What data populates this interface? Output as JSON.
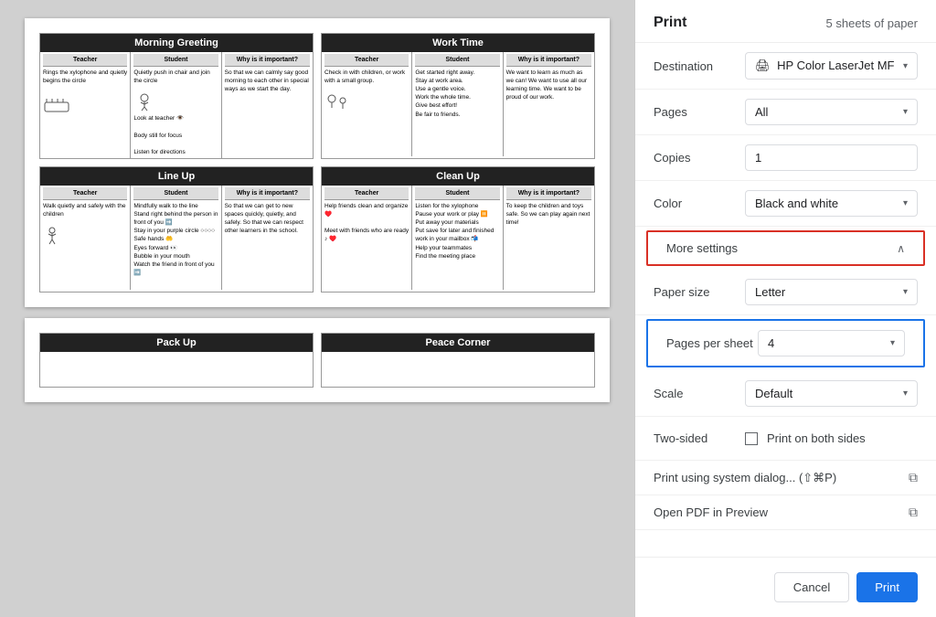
{
  "preview": {
    "page1": {
      "cards": [
        {
          "title": "Morning Greeting",
          "cols": [
            {
              "header": "Teacher",
              "content": "Rings the xylophone and quietly begins the circle"
            },
            {
              "header": "Student",
              "content": "Quietly push in chair and join the circle\n\nLook at teacher 👁️\n\nBody still for focus\n\nListen for directions"
            },
            {
              "header": "Why is it important?",
              "content": "So that we can calmly say good morning to each other in special ways as we start the day."
            }
          ]
        },
        {
          "title": "Work Time",
          "cols": [
            {
              "header": "Teacher",
              "content": "Check in with children, or work with a small group."
            },
            {
              "header": "Student",
              "content": "Get started right away.\nStay at work area.\nUse a gentle voice.\nWork the whole time.\nGive best effort!\nBe fair to friends."
            },
            {
              "header": "Why is it important?",
              "content": "We want to learn as much as we can!\nWe want to use all our learning time.\nWe want to be proud of our work."
            }
          ]
        },
        {
          "title": "Line Up",
          "cols": [
            {
              "header": "Teacher",
              "content": "Walk quietly and safely with the children"
            },
            {
              "header": "Student",
              "content": "Mindfully walk to the line\nStand right behind the person in front of you\nStay in your purple circle\nSafe hands\nEyes forward\nBubble in your mouth\nWatch the friend in front of you"
            },
            {
              "header": "Why is it important?",
              "content": "So that we can get to new spaces quickly, quietly, and safely.\nSo that we can respect other learners in the school."
            }
          ]
        },
        {
          "title": "Clean Up",
          "cols": [
            {
              "header": "Teacher",
              "content": "Help friends clean and organize\nMeet with friends who are ready"
            },
            {
              "header": "Student",
              "content": "Listen for the xylophone\nPause your work or play\nPut away your materials\nPut save for later and finished work in your mailbox\nHelp your teammates\nFind the meeting place"
            },
            {
              "header": "Why is it important?",
              "content": "To keep the children and toys safe.\nSo we can play again next time!"
            }
          ]
        }
      ]
    },
    "page2": {
      "cards": [
        {
          "title": "Pack Up",
          "partial": true
        },
        {
          "title": "Peace Corner",
          "partial": true
        }
      ]
    }
  },
  "settings": {
    "title": "Print",
    "sheets_info": "5 sheets of paper",
    "destination_label": "Destination",
    "destination_value": "HP Color LaserJet MF",
    "pages_label": "Pages",
    "pages_value": "All",
    "copies_label": "Copies",
    "copies_value": "1",
    "color_label": "Color",
    "color_value": "Black and white",
    "more_settings_label": "More settings",
    "paper_size_label": "Paper size",
    "paper_size_value": "Letter",
    "pages_per_sheet_label": "Pages per sheet",
    "pages_per_sheet_value": "4",
    "scale_label": "Scale",
    "scale_value": "Default",
    "two_sided_label": "Two-sided",
    "two_sided_checkbox_label": "Print on both sides",
    "system_dialog_label": "Print using system dialog... (⇧⌘P)",
    "open_pdf_label": "Open PDF in Preview",
    "cancel_label": "Cancel",
    "print_label": "Print"
  }
}
